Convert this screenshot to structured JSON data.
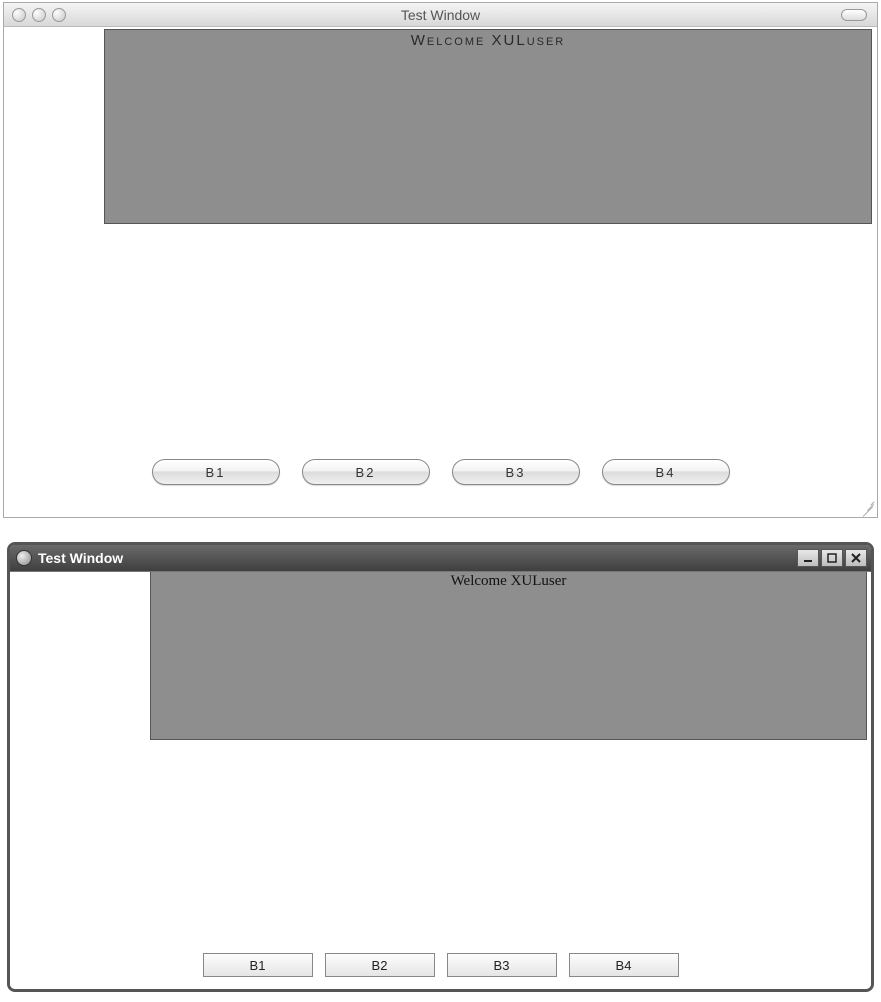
{
  "mac": {
    "title": "Test Window",
    "panel_heading": "Welcome XULuser",
    "buttons": {
      "b1": "B1",
      "b2": "B2",
      "b3": "B3",
      "b4": "B4"
    }
  },
  "win": {
    "title": "Test Window",
    "panel_heading": "Welcome XULuser",
    "buttons": {
      "b1": "B1",
      "b2": "B2",
      "b3": "B3",
      "b4": "B4"
    }
  }
}
